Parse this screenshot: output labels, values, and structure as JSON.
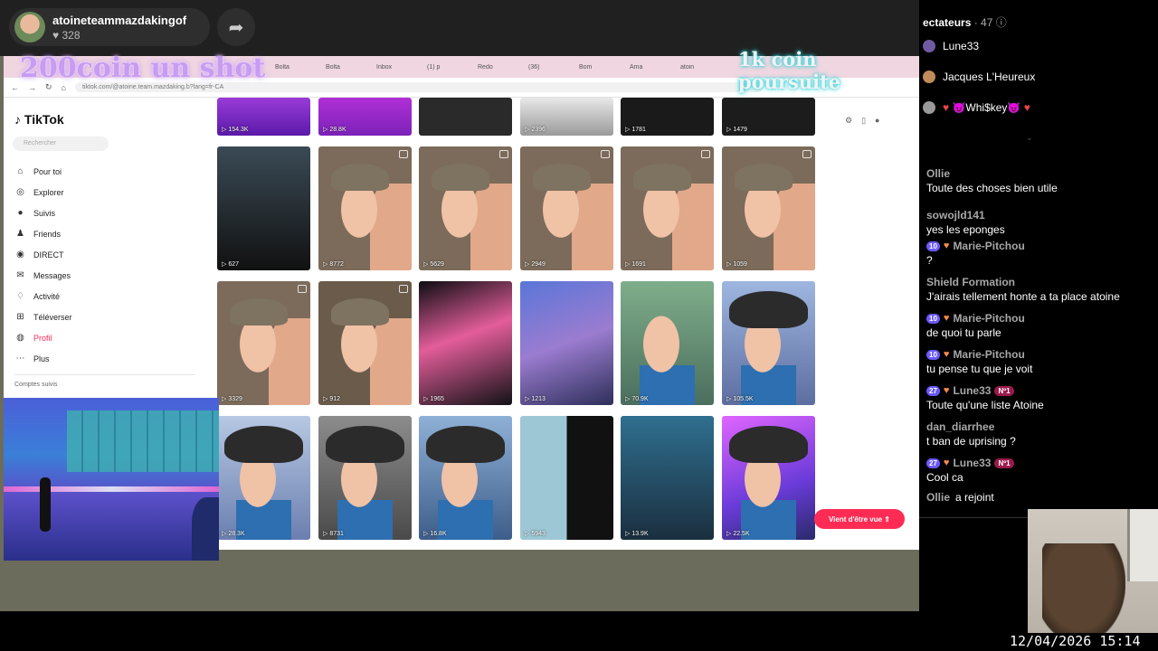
{
  "streamer": {
    "name": "atoineteammazdakingof",
    "likes": "328"
  },
  "overlays": {
    "left_text": "200coin un shot",
    "right_text": "1k coin poursuite"
  },
  "browser": {
    "tabs": [
      "Bolta",
      "Bolta",
      "Inbox",
      "(1) p",
      "Redo",
      "(36)",
      "Bom",
      "Ama",
      "atoin"
    ],
    "url": "tiktok.com/@atoine.team.mazdaking.b?lang=fr-CA"
  },
  "tiktok": {
    "logo": "TikTok",
    "search_placeholder": "Rechercher",
    "nav": [
      {
        "label": "Pour toi",
        "icon": "home-icon"
      },
      {
        "label": "Explorer",
        "icon": "compass-icon"
      },
      {
        "label": "Suivis",
        "icon": "following-icon"
      },
      {
        "label": "Friends",
        "icon": "friends-icon"
      },
      {
        "label": "DIRECT",
        "icon": "live-icon"
      },
      {
        "label": "Messages",
        "icon": "messages-icon"
      },
      {
        "label": "Activité",
        "icon": "activity-icon"
      },
      {
        "label": "Téléverser",
        "icon": "upload-icon"
      },
      {
        "label": "Profil",
        "icon": "profile-icon"
      },
      {
        "label": "Plus",
        "icon": "more-icon"
      }
    ],
    "comptes_suivis": "Comptes suivis",
    "videos": [
      {
        "views": "154.3K"
      },
      {
        "views": "28.8K"
      },
      {
        "views": ""
      },
      {
        "views": "2396"
      },
      {
        "views": "1781"
      },
      {
        "views": "1479"
      },
      {
        "views": "627"
      },
      {
        "views": "8772"
      },
      {
        "views": "5629"
      },
      {
        "views": "2949"
      },
      {
        "views": "1691"
      },
      {
        "views": "1059"
      },
      {
        "views": "3329"
      },
      {
        "views": "912"
      },
      {
        "views": "1965"
      },
      {
        "views": "1213"
      },
      {
        "views": "70.9K"
      },
      {
        "views": "105.5K"
      },
      {
        "views": "28.3K"
      },
      {
        "views": "8731"
      },
      {
        "views": "16.8K"
      },
      {
        "views": "5943"
      },
      {
        "views": "13.9K"
      },
      {
        "views": "22.5K"
      }
    ],
    "vient_button": "Vient d'être vue"
  },
  "chat": {
    "viewers_label": "ectateurs",
    "viewers_count": "· 47",
    "top_viewers": [
      "Lune33",
      "Jacques L'Heureux",
      "Whi$key"
    ],
    "messages": [
      {
        "user": "Ollie",
        "text": "Toute des choses bien utile"
      },
      {
        "user": "sowojld141",
        "text": "yes les eponges"
      },
      {
        "user": "Marie-Pitchou",
        "level": "10",
        "text": "?"
      },
      {
        "user": "Shield Formation",
        "text": "J'airais tellement honte a ta place atoine"
      },
      {
        "user": "Marie-Pitchou",
        "level": "10",
        "text": "de quoi tu parle"
      },
      {
        "user": "Marie-Pitchou",
        "level": "10",
        "text": "tu pense tu que je voit"
      },
      {
        "user": "Lune33",
        "level": "27",
        "rank": "Nº1",
        "text": "Toute qu'une liste Atoine"
      },
      {
        "user": "dan_diarrhee",
        "text": "t ban de uprising ?"
      },
      {
        "user": "Lune33",
        "level": "27",
        "rank": "Nº1",
        "text": "Cool ca"
      }
    ],
    "joined_user": "Ollie",
    "joined_text": "a rejoint"
  },
  "timestamp": "12/04/2026 15:14"
}
